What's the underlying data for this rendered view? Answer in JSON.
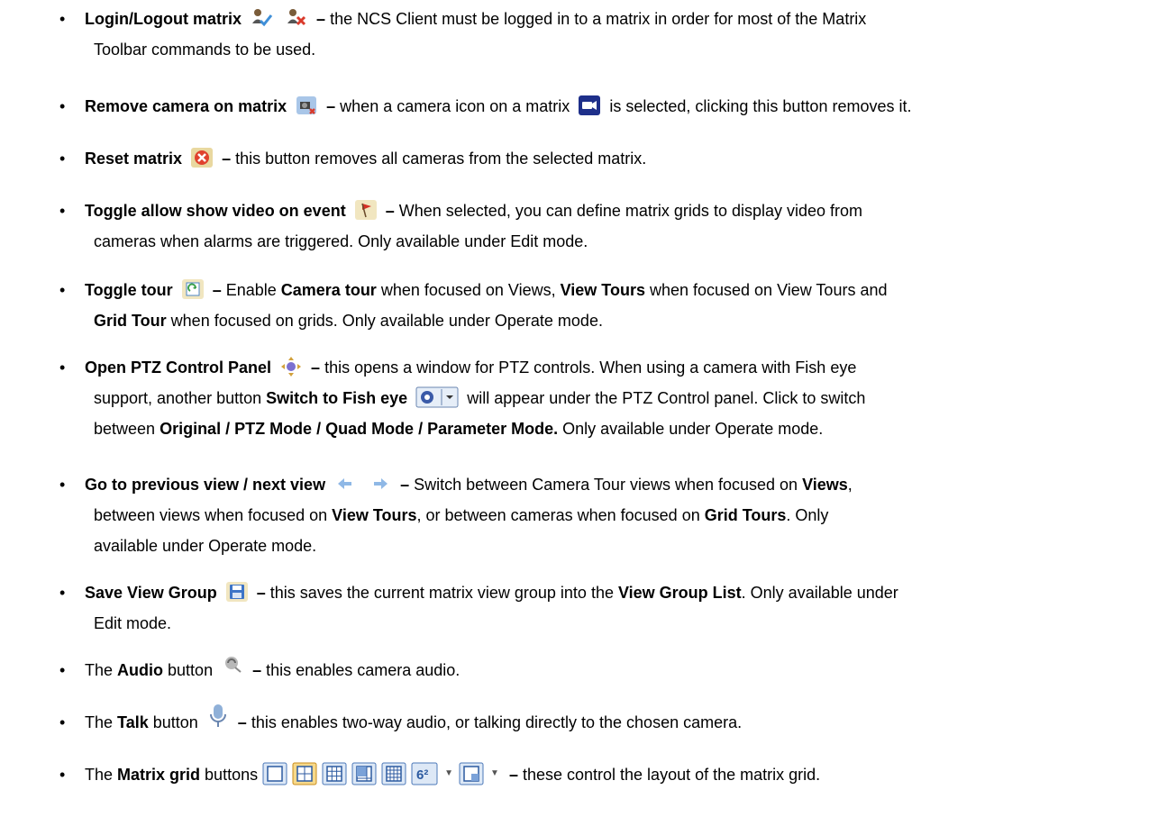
{
  "items": [
    {
      "title": "Login/Logout matrix",
      "icons": [
        "login-icon",
        "logout-icon"
      ],
      "line1": "the NCS Client must be logged in to a matrix in order for most of the Matrix",
      "line2": "Toolbar commands to be used."
    },
    {
      "title": "Remove camera on matrix",
      "icons": [
        "remove-camera-icon",
        "matrix-camera-icon"
      ],
      "text_a": "when a camera icon on a matrix",
      "text_b": "is selected, clicking this button removes it."
    },
    {
      "title": "Reset matrix",
      "icons": [
        "reset-icon"
      ],
      "text": "this button removes all cameras from the selected matrix."
    },
    {
      "title": "Toggle allow show video on event",
      "icons": [
        "flag-icon"
      ],
      "line1": "When selected, you can define matrix grids to display video from",
      "line2": "cameras when alarms are triggered.  Only available under Edit mode."
    },
    {
      "title": "Toggle tour",
      "icons": [
        "tour-icon"
      ],
      "l1a": "Enable ",
      "l1b": "Camera tour",
      "l1c": " when focused on Views, ",
      "l1d": "View Tours",
      "l1e": " when focused on View Tours and",
      "l2a": "Grid Tour",
      "l2b": " when focused on grids.  Only available under Operate mode."
    },
    {
      "title": "Open PTZ Control Panel",
      "icons": [
        "ptz-icon",
        "fisheye-icon"
      ],
      "line1": "this opens a window for PTZ controls.  When using a camera with Fish eye",
      "l2a": "support, another button ",
      "l2b": "Switch to Fish eye",
      "l2c": " will appear under the PTZ Control panel.  Click to switch",
      "l3a": "between ",
      "l3b": "Original / PTZ Mode / Quad Mode / Parameter Mode.",
      "l3c": "  Only available under Operate mode."
    },
    {
      "title": "Go to previous view / next view",
      "icons": [
        "prev-arrow-icon",
        "next-arrow-icon"
      ],
      "l1a": "Switch between Camera Tour views when focused on ",
      "l1b": "Views",
      "l1c": ",",
      "l2a": "between views when focused on ",
      "l2b": "View Tours",
      "l2c": ", or between cameras when focused on ",
      "l2d": "Grid Tours",
      "l2e": ".  Only",
      "line3": "available under Operate mode."
    },
    {
      "title": "Save View Group",
      "icons": [
        "save-icon"
      ],
      "l1a": "this saves the current matrix view group into the ",
      "l1b": "View Group List",
      "l1c": ".  Only available under",
      "line2": "Edit mode."
    },
    {
      "pre": "The ",
      "title": "Audio",
      "post": " button",
      "icons": [
        "audio-icon"
      ],
      "text": "this enables camera audio."
    },
    {
      "pre": "The ",
      "title": "Talk",
      "post": " button",
      "icons": [
        "microphone-icon"
      ],
      "text": "this enables two-way audio, or talking directly to the chosen camera."
    },
    {
      "pre": "The ",
      "title": "Matrix grid",
      "post": " buttons",
      "icons": [
        "grid-1x1-icon",
        "grid-2x2-icon",
        "grid-3x3-icon",
        "grid-4x3-icon",
        "grid-4x4-icon",
        "grid-custom-icon",
        "grid-dropdown-icon"
      ],
      "grid_label": "6²",
      "text": "these control the layout of the matrix grid."
    }
  ],
  "bullet": "•",
  "dash": "–"
}
